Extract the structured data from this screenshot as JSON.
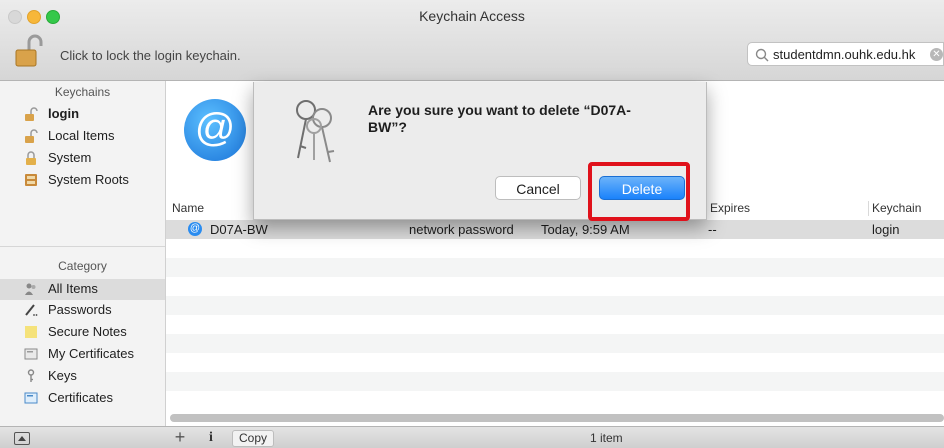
{
  "window": {
    "title": "Keychain Access"
  },
  "toolbar": {
    "lock_label": "Click to lock the login keychain.",
    "search_value": "studentdmn.ouhk.edu.hk"
  },
  "sidebar": {
    "keychains_header": "Keychains",
    "keychains": [
      {
        "label": "login",
        "icon": "unlocked-padlock-icon"
      },
      {
        "label": "Local Items",
        "icon": "unlocked-padlock-icon"
      },
      {
        "label": "System",
        "icon": "locked-padlock-icon"
      },
      {
        "label": "System Roots",
        "icon": "cabinet-icon"
      }
    ],
    "category_header": "Category",
    "categories": [
      {
        "label": "All Items",
        "icon": "people-icon"
      },
      {
        "label": "Passwords",
        "icon": "pen-icon"
      },
      {
        "label": "Secure Notes",
        "icon": "note-icon"
      },
      {
        "label": "My Certificates",
        "icon": "certificate-icon"
      },
      {
        "label": "Keys",
        "icon": "key-icon"
      },
      {
        "label": "Certificates",
        "icon": "certificate-icon"
      }
    ]
  },
  "table": {
    "columns": [
      "Name",
      "Expires",
      "Keychain"
    ],
    "rows": [
      {
        "name": "D07A-BW",
        "kind": "network password",
        "modified": "Today, 9:59 AM",
        "expires": "--",
        "keychain": "login"
      }
    ]
  },
  "bottombar": {
    "add_label": "+",
    "info_label": "i",
    "copy_label": "Copy",
    "item_count": "1 item"
  },
  "dialog": {
    "message": "Are you sure you want to delete “D07A-BW”?",
    "cancel_label": "Cancel",
    "delete_label": "Delete"
  },
  "colors": {
    "accent": "#1a82fb",
    "highlight": "#e0111b",
    "selection": "#dcdcdc"
  }
}
